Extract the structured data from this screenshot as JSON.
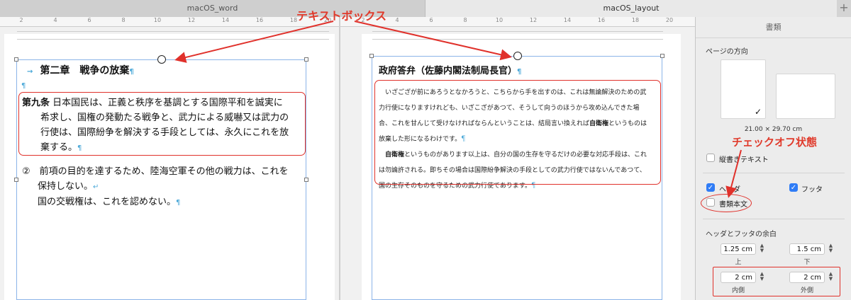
{
  "tabs": [
    {
      "label": "macOS_word"
    },
    {
      "label": "macOS_layout"
    }
  ],
  "tab_add_label": "+",
  "left_ruler": [
    "2",
    "4",
    "6",
    "8",
    "10",
    "12",
    "14",
    "16",
    "18",
    "20"
  ],
  "right_ruler": [
    "2",
    "4",
    "6",
    "8",
    "10",
    "12",
    "14",
    "16",
    "18",
    "20"
  ],
  "left_doc": {
    "chapter_title": "第二章　戦争の放棄",
    "art9_lead": "第九条",
    "art9_line1": "日本国民は、正義と秩序を基調とする国際平和を誠実に",
    "art9_line2": "希求し、国権の発動たる戦争と、武力による威嚇又は武力の",
    "art9_line3": "行使は、国際紛争を解決する手段としては、永久にこれを放",
    "art9_line4": "棄する。",
    "item2_line1": "②　前項の目的を達するため、陸海空軍その他の戦力は、これを",
    "item2_line2": "保持しない。",
    "item2_line3": "国の交戦権は、これを認めない。",
    "para_mark": "¶",
    "tab_mark": "→",
    "break_mark": "↵"
  },
  "right_doc": {
    "title": "政府答弁（佐藤内閣法制局長官）",
    "p1_line1": "いざござが前にあろうとなかろうと、こちらから手を出すのは、これは無論解決のための武",
    "p1_line2": "力行使になりますけれども、いざこざがあつて、そうして向うのほうから攻め込んできた場",
    "p1_line3a": "合、これを甘んじて受けなければならんということは、結局言い換えれば",
    "p1_bold": "自衛権",
    "p1_line3b": "というものは",
    "p1_line4": "放棄した形になるわけです。",
    "p2_bold": "自衛権",
    "p2_line1": "というものがあります以上は、自分の国の生存を守るだけの必要な対応手段は、これ",
    "p2_line2": "は勿論許される。即ちその場合は国際紛争解決の手段としての武力行使ではないんであつて、",
    "p2_line3": "国の生存そのものを守るための武力行使であります。"
  },
  "annotations": {
    "textbox_label": "テキストボックス",
    "checkoff_label": "チェックオフ状態"
  },
  "inspector": {
    "title": "書類",
    "orientation_label": "ページの方向",
    "checkmark": "✓",
    "page_size": "21.00 × 29.70 cm",
    "vertical_text_label": "縦書きテキスト",
    "header_label": "ヘッダ",
    "footer_label": "フッタ",
    "body_label": "書類本文",
    "hf_margin_label": "ヘッダとフッタの余白",
    "top_value": "1.25 cm",
    "top_caption": "上",
    "bottom_value": "1.5 cm",
    "bottom_caption": "下",
    "inner_value": "2 cm",
    "inner_caption": "内側",
    "outer_value": "2 cm",
    "outer_caption": "外側",
    "header_checked": true,
    "footer_checked": true,
    "body_checked": false,
    "vertical_checked": false
  },
  "colors": {
    "annotation_red": "#e0312b",
    "checkbox_blue": "#2f7cf6",
    "paragraph_mark": "#4aa8d8"
  }
}
